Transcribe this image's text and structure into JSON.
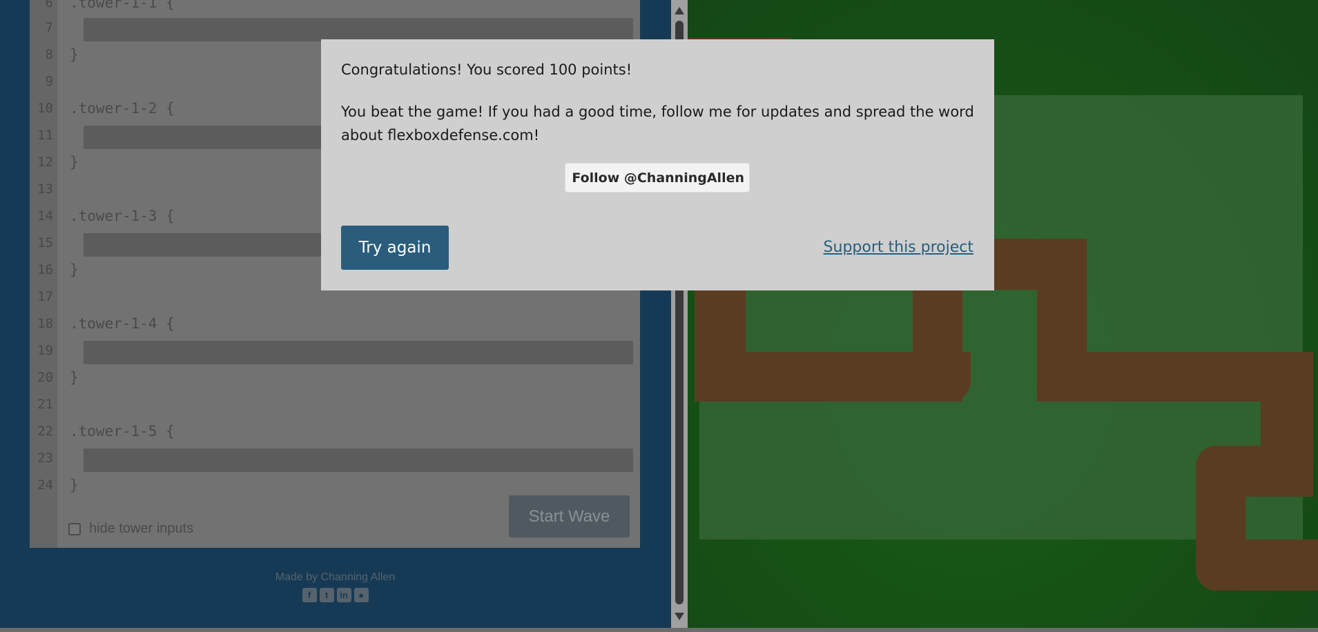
{
  "editor": {
    "lines": [
      {
        "num": "6",
        "code": ".tower-1-1 {"
      },
      {
        "num": "7",
        "code": ""
      },
      {
        "num": "8",
        "code": "}"
      },
      {
        "num": "9",
        "code": ""
      },
      {
        "num": "10",
        "code": ".tower-1-2 {"
      },
      {
        "num": "11",
        "code": ""
      },
      {
        "num": "12",
        "code": "}"
      },
      {
        "num": "13",
        "code": ""
      },
      {
        "num": "14",
        "code": ".tower-1-3 {"
      },
      {
        "num": "15",
        "code": ""
      },
      {
        "num": "16",
        "code": "}"
      },
      {
        "num": "17",
        "code": ""
      },
      {
        "num": "18",
        "code": ".tower-1-4 {"
      },
      {
        "num": "19",
        "code": ""
      },
      {
        "num": "20",
        "code": "}"
      },
      {
        "num": "21",
        "code": ""
      },
      {
        "num": "22",
        "code": ".tower-1-5 {"
      },
      {
        "num": "23",
        "code": ""
      },
      {
        "num": "24",
        "code": "}"
      }
    ],
    "hide_label": "hide tower inputs",
    "start_wave_label": "Start Wave"
  },
  "footer": {
    "made_by": "Made by Channing Allen",
    "social_icons": [
      "facebook-icon",
      "twitter-icon",
      "linkedin-icon",
      "github-icon"
    ]
  },
  "modal": {
    "score_message": "Congratulations! You scored 100 points!",
    "beat_message": "You beat the game! If you had a good time, follow me for updates and spread the word about flexboxdefense.com!",
    "follow_label": "Follow @ChanningAllen",
    "try_again_label": "Try again",
    "support_label": "Support this project"
  },
  "colors": {
    "accent": "#2a5d7c",
    "modal_bg": "#cfcfcf",
    "board_green": "#036003",
    "path_brown": "#6a3c14",
    "page_bg": "#163a55"
  }
}
